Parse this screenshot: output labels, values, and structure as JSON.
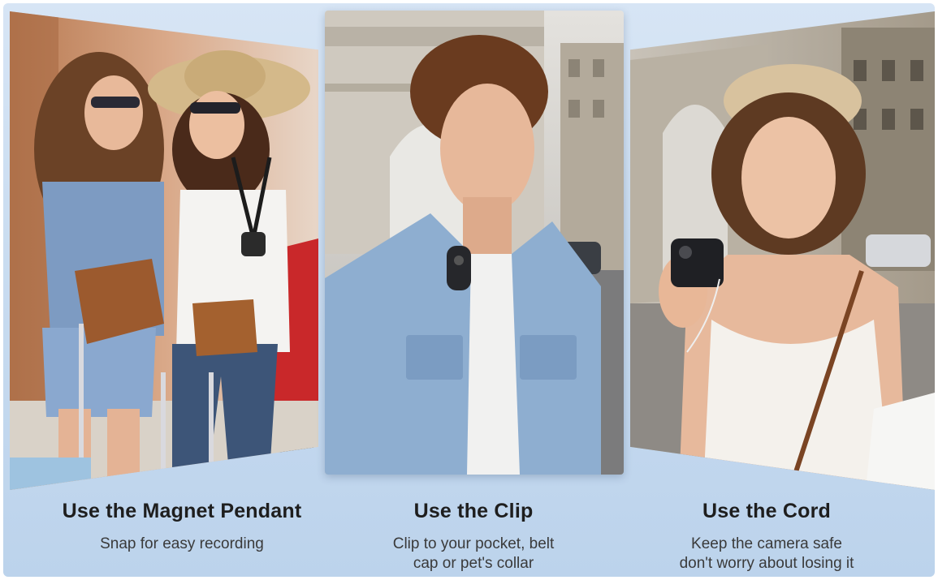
{
  "panels": [
    {
      "title": "Use the Magnet Pendant",
      "description_lines": [
        "Snap for easy recording"
      ]
    },
    {
      "title": "Use the Clip",
      "description_lines": [
        "Clip to your pocket, belt",
        "cap or pet's collar"
      ]
    },
    {
      "title": "Use the Cord",
      "description_lines": [
        "Keep the camera safe",
        "don't worry about losing it"
      ]
    }
  ],
  "colors": {
    "background": "#c9dcf0",
    "title_text": "#1e1e1e",
    "body_text": "#3a3a3a"
  }
}
